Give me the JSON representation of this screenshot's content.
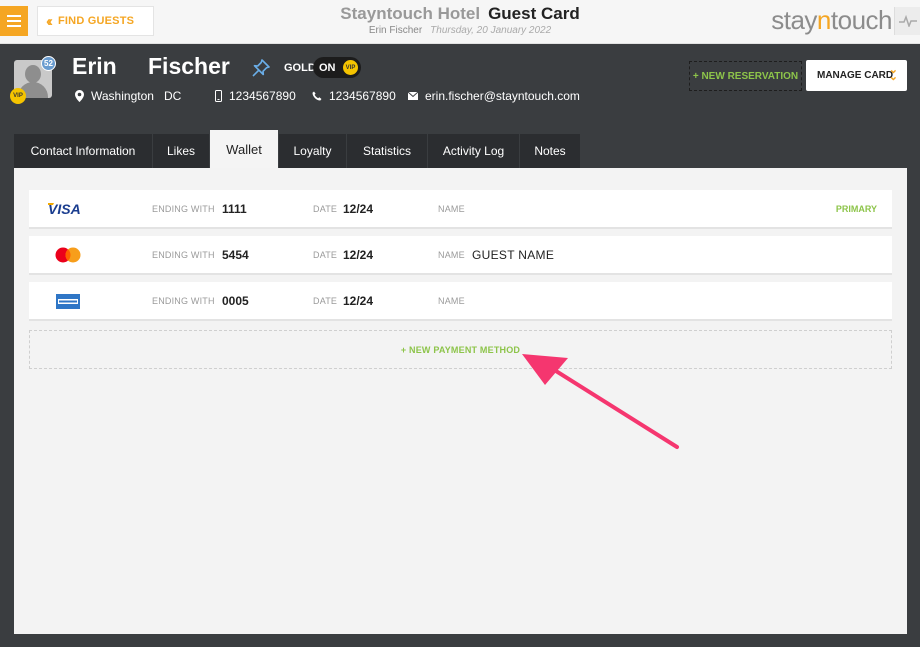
{
  "topbar": {
    "find_guests_label": "FIND GUESTS",
    "hotel_name": "Stayntouch Hotel",
    "page_title": "Guest Card",
    "guest_name": "Erin Fischer",
    "date": "Thursday, 20 January 2022",
    "logo": {
      "part1": "stay",
      "part2": "n",
      "part3": "touch"
    }
  },
  "guest": {
    "first_name": "Erin",
    "last_name": "Fischer",
    "avatar_badge_count": "52",
    "vip_badge": "VIP",
    "membership_level": "GOLD",
    "membership_toggle": "ON",
    "membership_toggle_badge": "VIP",
    "city": "Washington",
    "state": "DC",
    "mobile": "1234567890",
    "phone": "1234567890",
    "email": "erin.fischer@stayntouch.com"
  },
  "actions": {
    "new_reservation": "+ NEW RESERVATION",
    "manage_card": "MANAGE CARD"
  },
  "tabs": [
    {
      "label": "Contact Information",
      "active": false
    },
    {
      "label": "Likes",
      "active": false
    },
    {
      "label": "Wallet",
      "active": true
    },
    {
      "label": "Loyalty",
      "active": false
    },
    {
      "label": "Statistics",
      "active": false
    },
    {
      "label": "Activity Log",
      "active": false
    },
    {
      "label": "Notes",
      "active": false
    }
  ],
  "wallet": {
    "labels": {
      "ending_with": "ENDING WITH",
      "date": "DATE",
      "name": "NAME"
    },
    "cards": [
      {
        "brand": "VISA",
        "icon": "visa-logo",
        "ending": "1111",
        "date": "12/24",
        "name": "",
        "primary_label": "PRIMARY"
      },
      {
        "brand": "MasterCard",
        "icon": "mastercard-logo",
        "ending": "5454",
        "date": "12/24",
        "name": "GUEST NAME",
        "primary_label": ""
      },
      {
        "brand": "American Express",
        "icon": "amex-logo",
        "ending": "0005",
        "date": "12/24",
        "name": "",
        "primary_label": ""
      }
    ],
    "new_payment_label": "+ NEW PAYMENT METHOD"
  },
  "colors": {
    "accent": "#f5a623",
    "success": "#8dc44a",
    "header_bg": "#3a3d40",
    "annotation_arrow": "#f5366f"
  }
}
